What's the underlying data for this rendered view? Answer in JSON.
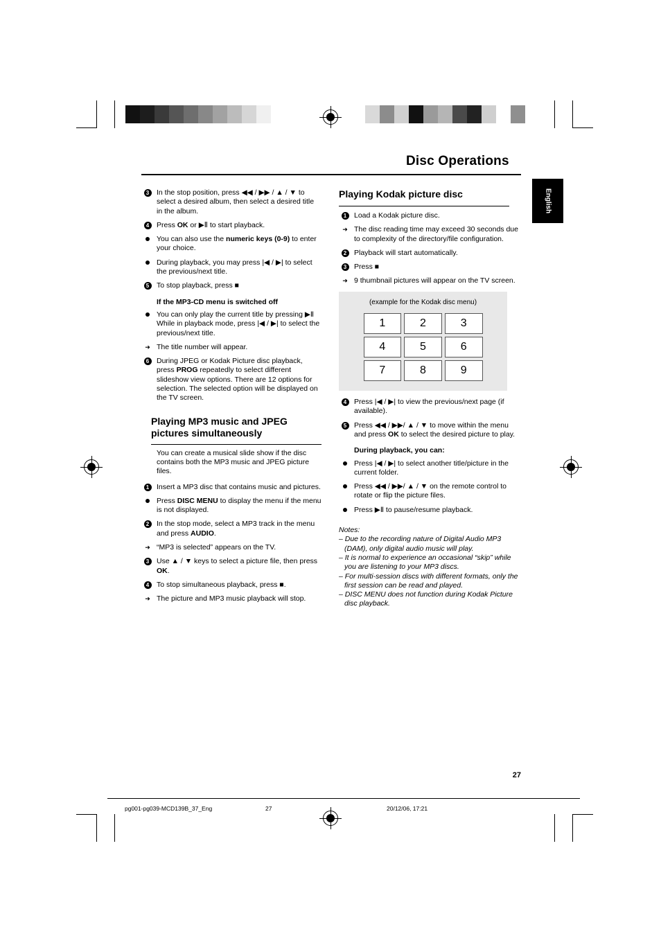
{
  "header": {
    "title": "Disc Operations",
    "language_tab": "English"
  },
  "left_column": {
    "items": [
      {
        "marker": "3",
        "type": "num",
        "text": "In the stop position, press ◀◀ / ▶▶  /  ▲  /  ▼  to select a desired album, then select a desired title in the album."
      },
      {
        "marker": "4",
        "type": "num",
        "html": "Press <b>OK</b> or <span class=\"symbol\">▶Ⅱ</span> to start playback."
      },
      {
        "marker": "dot",
        "type": "dot",
        "html": "You can also use the <b>numeric keys (0-9)</b> to enter your choice."
      },
      {
        "marker": "dot",
        "type": "dot",
        "text": "During playback, you may press |◀ / ▶| to select the previous/next title."
      },
      {
        "marker": "5",
        "type": "num",
        "text": "To stop playback, press ■"
      }
    ],
    "sub_head": "If the MP3-CD menu is switched off",
    "items2": [
      {
        "marker": "dot",
        "type": "dot",
        "text": "You can only play the current title by pressing ▶Ⅱ While in playback mode, press |◀ / ▶| to select the previous/next title."
      },
      {
        "marker": "arrow",
        "type": "arrow",
        "text": "The title number will appear."
      },
      {
        "marker": "6",
        "type": "num",
        "html": "During JPEG or Kodak Picture disc playback, press <b>PROG</b> repeatedly to select different slideshow view options. There are 12 options for selection. The selected option will be displayed on the TV screen."
      }
    ],
    "section_head": "Playing MP3 music and JPEG pictures simultaneously",
    "section_intro": "You can create a musical slide show if the disc contains both the MP3 music and JPEG picture files.",
    "items3": [
      {
        "marker": "1",
        "type": "num",
        "text": "Insert a MP3 disc that contains music and pictures."
      },
      {
        "marker": "dot",
        "type": "dot",
        "html": "Press <b>DISC MENU</b> to display the menu if the menu is not displayed."
      },
      {
        "marker": "2",
        "type": "num",
        "html": "In the stop mode, select a MP3 track in the menu and press <b>AUDIO</b>."
      },
      {
        "marker": "arrow",
        "type": "arrow",
        "text": "“MP3 is selected” appears on the TV."
      },
      {
        "marker": "3",
        "type": "num",
        "html": "Use ▲ / ▼ keys to select a picture file, then press <b>OK</b>."
      },
      {
        "marker": "4",
        "type": "num",
        "text": "To stop simultaneous playback, press ■."
      },
      {
        "marker": "arrow",
        "type": "arrow",
        "text": "The picture and MP3 music playback will stop."
      }
    ]
  },
  "right_column": {
    "section_head": "Playing Kodak picture disc",
    "items": [
      {
        "marker": "1",
        "type": "num",
        "text": "Load a Kodak picture disc."
      },
      {
        "marker": "arrow",
        "type": "arrow",
        "text": "The disc reading time may exceed 30 seconds due to complexity of the directory/file configuration."
      },
      {
        "marker": "2",
        "type": "num",
        "text": "Playback will start automatically."
      },
      {
        "marker": "3",
        "type": "num",
        "text": "Press ■"
      },
      {
        "marker": "arrow",
        "type": "arrow",
        "text": "9 thumbnail pictures will appear on the TV screen."
      }
    ],
    "kodak_box": {
      "caption": "(example for the Kodak disc menu)",
      "cells": [
        "1",
        "2",
        "3",
        "4",
        "5",
        "6",
        "7",
        "8",
        "9"
      ]
    },
    "items2": [
      {
        "marker": "4",
        "type": "num",
        "text": "Press |◀ / ▶| to view the previous/next page (if available)."
      },
      {
        "marker": "5",
        "type": "num",
        "html": "Press ◀◀ / ▶▶/ ▲ / ▼ to move within the menu and press <b>OK</b> to select the desired picture to play."
      }
    ],
    "sub_head": "During playback, you can:",
    "items3": [
      {
        "marker": "dot",
        "type": "dot",
        "text": "Press |◀ / ▶| to select another title/picture in the current folder."
      },
      {
        "marker": "dot",
        "type": "dot",
        "text": "Press ◀◀ / ▶▶/ ▲ / ▼ on the remote control to rotate or flip the picture files."
      },
      {
        "marker": "dot",
        "type": "dot",
        "text": "Press ▶Ⅱ to pause/resume playback."
      }
    ],
    "notes_label": "Notes:",
    "notes": [
      "–  Due to the recording nature of Digital Audio MP3 (DAM), only digital audio music will play.",
      "–  It is normal to experience an occasional “skip” while you are listening to your MP3 discs.",
      "–  For multi-session discs with different formats, only the first session can be read and played.",
      "–  DISC MENU does not function during Kodak Picture disc playback."
    ]
  },
  "footer": {
    "page_number": "27",
    "file_name": "pg001-pg039-MCD139B_37_Eng",
    "footer_page": "27",
    "date": "20/12/06, 17:21"
  },
  "greybars": {
    "left": [
      "#111111",
      "#1d1d1d",
      "#3a3a3a",
      "#555555",
      "#6e6e6e",
      "#888888",
      "#a2a2a2",
      "#bcbcbc",
      "#d6d6d6",
      "#f0f0f0",
      "#ffffff"
    ],
    "right": [
      "#d9d9d9",
      "#8c8c8c",
      "#d0d0d0",
      "#111111",
      "#9a9a9a",
      "#b5b5b5",
      "#4a4a4a",
      "#222222",
      "#cfcfcf",
      "#ffffff",
      "#8f8f8f"
    ]
  }
}
